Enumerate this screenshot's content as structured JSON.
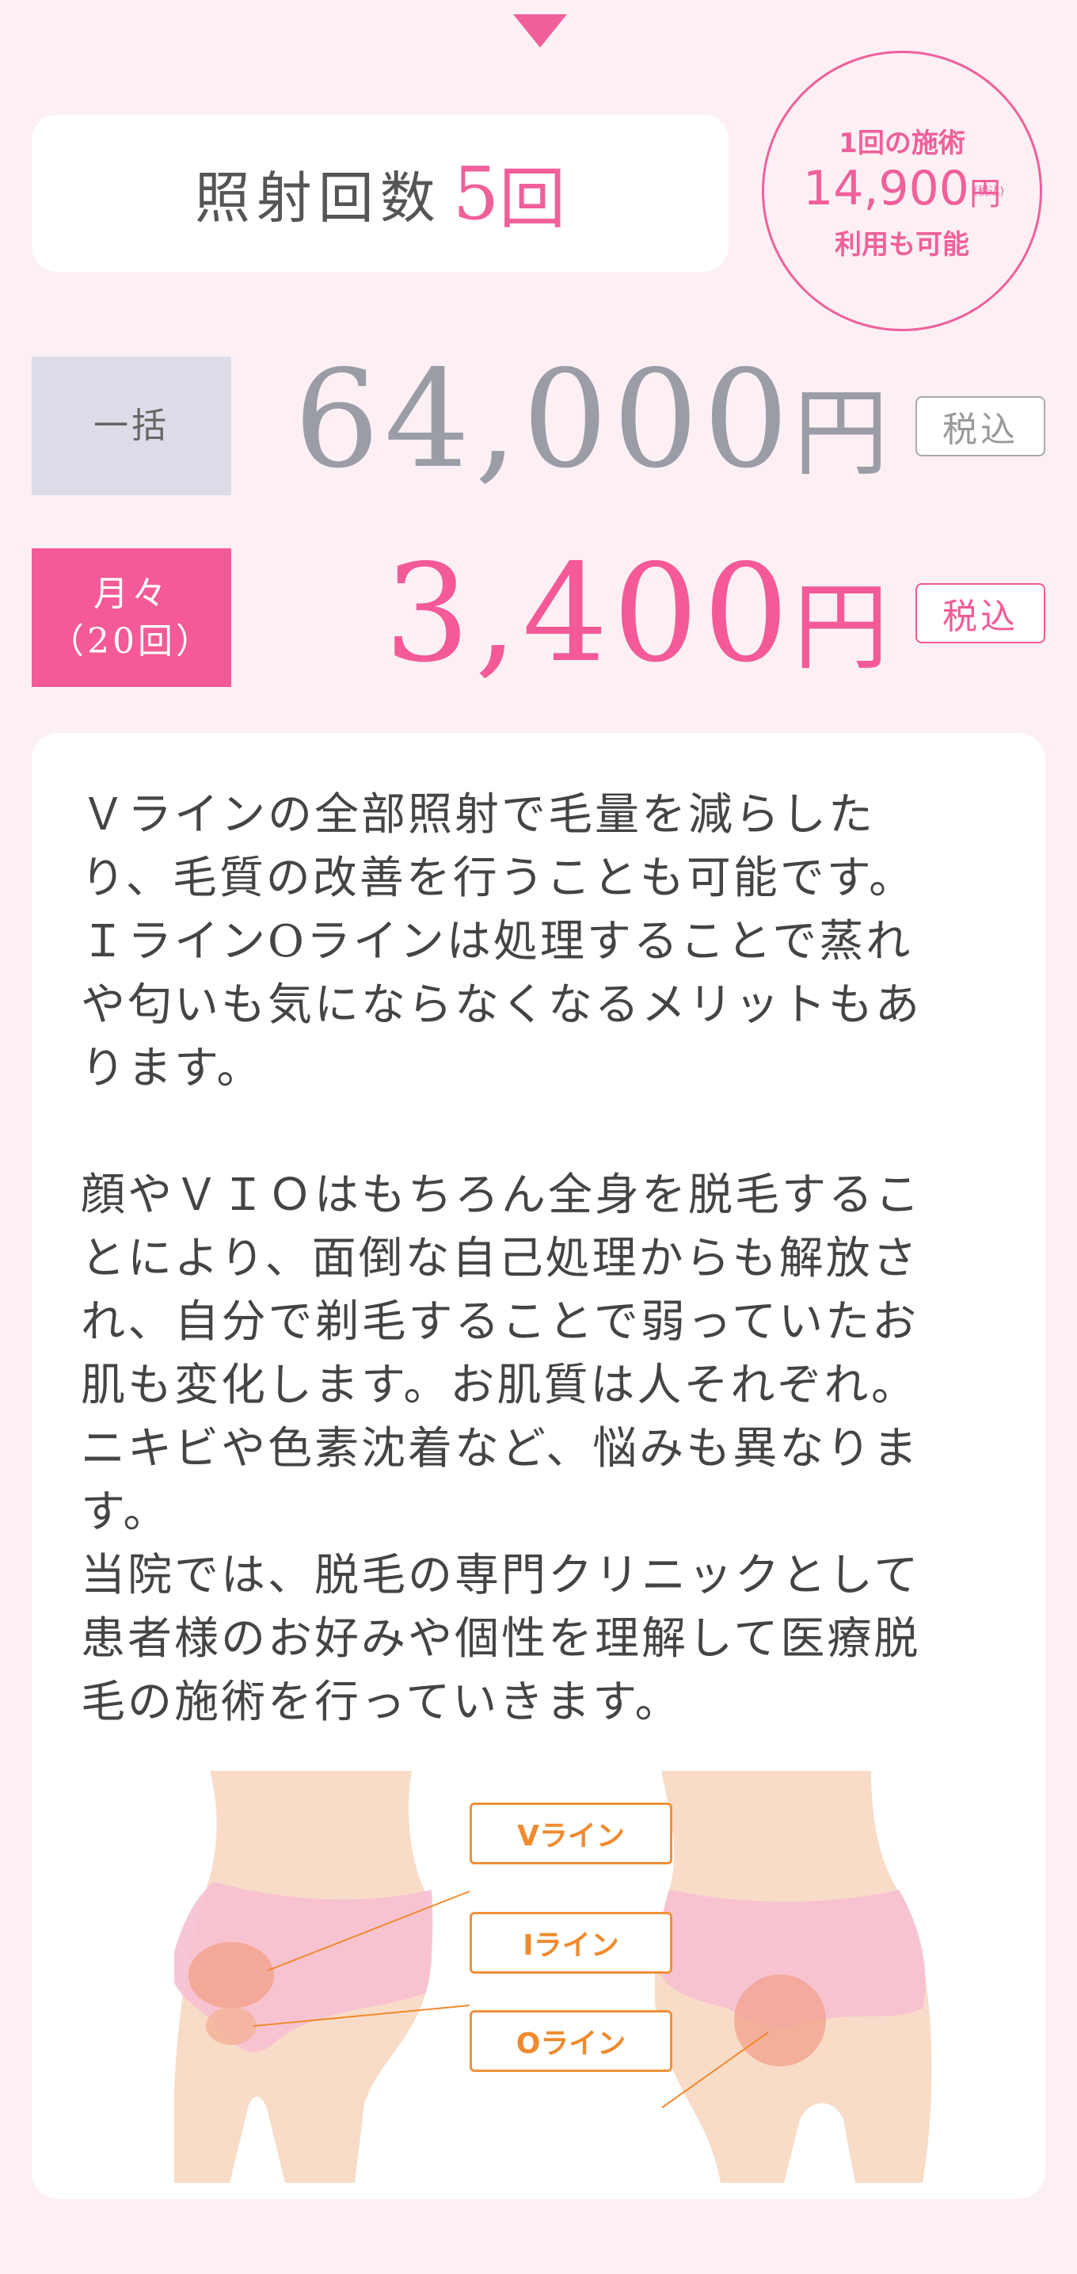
{
  "session_count": {
    "label": "照射回数",
    "value": "5",
    "unit": "回"
  },
  "single_offer": {
    "line1": "1回の施術",
    "price": "14,900",
    "yen": "円",
    "tax": "(税込)",
    "line3": "利用も可能"
  },
  "lump_sum": {
    "tag": "一括",
    "price": "64,000",
    "yen": "円",
    "tax": "税込"
  },
  "monthly": {
    "tag_line1": "月々",
    "tag_line2": "（20回）",
    "price": "3,400",
    "yen": "円",
    "tax": "税込"
  },
  "description": "Ｖラインの全部照射で毛量を減らした\nり、毛質の改善を行うことも可能です。\nＩラインOラインは処理することで蒸れ\nや匂いも気にならなくなるメリットもあ\nります。\n\n顔やＶＩＯはもちろん全身を脱毛するこ\nとにより、面倒な自己処理からも解放さ\nれ、自分で剃毛することで弱っていたお\n肌も変化します。お肌質は人それぞれ。\nニキビや色素沈着など、悩みも異なりま\nす。\n当院では、脱毛の専門クリニックとして\n患者様のお好みや個性を理解して医療脱\n毛の施術を行っていきます。",
  "diagram_labels": {
    "v": "Vライン",
    "i": "Iライン",
    "o": "Oライン"
  },
  "colors": {
    "accent": "#f45a97",
    "background": "#fdf0f5",
    "label_orange": "#f08a2e"
  }
}
